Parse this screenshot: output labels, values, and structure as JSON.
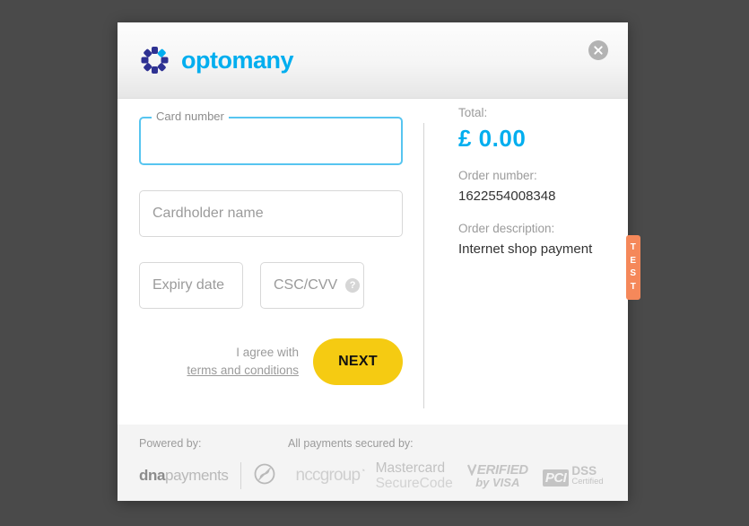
{
  "header": {
    "brand_name": "optomany",
    "close_label": "close-icon"
  },
  "form": {
    "card_number": {
      "label": "Card number",
      "value": "",
      "placeholder": ""
    },
    "cardholder_name": {
      "value": "",
      "placeholder": "Cardholder name"
    },
    "expiry_date": {
      "value": "",
      "placeholder": "Expiry date"
    },
    "csc": {
      "value": "",
      "placeholder": "CSC/CVV",
      "help_glyph": "?"
    },
    "agree_text": "I agree with",
    "terms_link": "terms and conditions",
    "next_label": "NEXT"
  },
  "summary": {
    "total_label": "Total:",
    "total_value": "£ 0.00",
    "order_number_label": "Order number:",
    "order_number_value": "1622554008348",
    "order_description_label": "Order description:",
    "order_description_value": "Internet shop payment"
  },
  "test_tab": {
    "letters": [
      "T",
      "E",
      "S",
      "T"
    ]
  },
  "footer": {
    "powered_by_label": "Powered by:",
    "secured_by_label": "All payments secured by:",
    "dna_bold": "dna",
    "dna_light": "payments",
    "ncc": "nccgroup",
    "ncc_sup": "◔",
    "mastercard_line1": "Mastercard",
    "mastercard_line2": "SecureCode",
    "visa_line1": "ERIFIED",
    "visa_line2": "by VISA",
    "pci_box": "PCI",
    "pci_line1": "DSS",
    "pci_line2": "Certified"
  },
  "colors": {
    "brand_cyan": "#00aeef",
    "brand_navy": "#2e3192",
    "focus_border": "#57c5f0",
    "next_yellow": "#f5cb12",
    "test_orange": "#f5885a",
    "page_background": "#4a4a4a"
  }
}
